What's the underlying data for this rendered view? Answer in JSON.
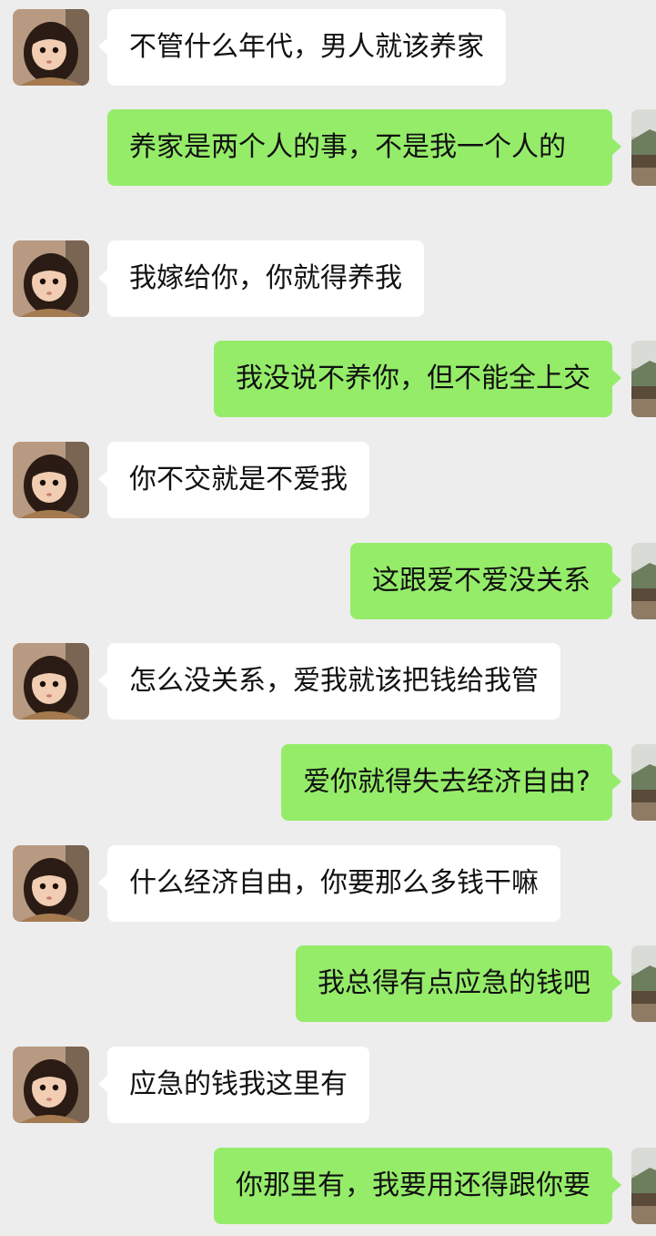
{
  "colors": {
    "background": "#ededed",
    "incoming_bubble": "#ffffff",
    "outgoing_bubble": "#95ec69",
    "text": "#111111"
  },
  "avatars": {
    "incoming": "child-photo-avatar",
    "outgoing": "landscape-photo-avatar"
  },
  "messages": [
    {
      "side": "left",
      "text": "不管什么年代，男人就该养家"
    },
    {
      "side": "right",
      "text": "养家是两个人的事，不是我一个人的"
    },
    {
      "side": "left",
      "text": "我嫁给你，你就得养我"
    },
    {
      "side": "right",
      "text": "我没说不养你，但不能全上交"
    },
    {
      "side": "left",
      "text": "你不交就是不爱我"
    },
    {
      "side": "right",
      "text": "这跟爱不爱没关系"
    },
    {
      "side": "left",
      "text": "怎么没关系，爱我就该把钱给我管"
    },
    {
      "side": "right",
      "text": "爱你就得失去经济自由?"
    },
    {
      "side": "left",
      "text": "什么经济自由，你要那么多钱干嘛"
    },
    {
      "side": "right",
      "text": "我总得有点应急的钱吧"
    },
    {
      "side": "left",
      "text": "应急的钱我这里有"
    },
    {
      "side": "right",
      "text": "你那里有，我要用还得跟你要"
    }
  ]
}
